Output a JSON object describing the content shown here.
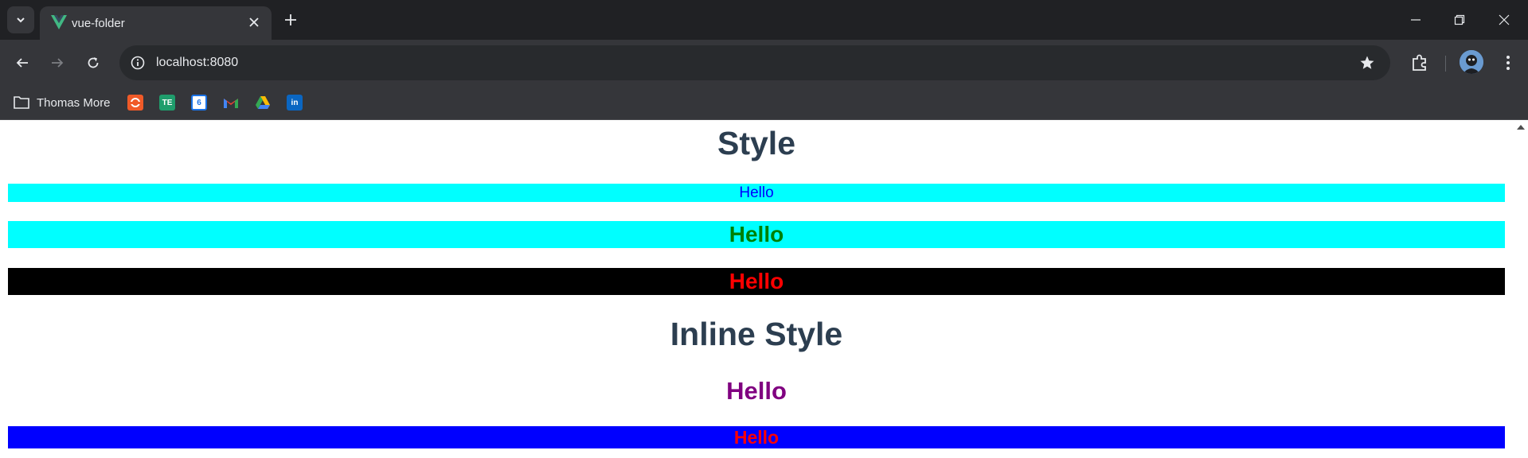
{
  "browser": {
    "tab": {
      "title": "vue-folder",
      "favicon_icon": "vue-logo-icon"
    },
    "address_bar": {
      "url": "localhost:8080"
    },
    "bookmarks": {
      "folder_label": "Thomas More",
      "items": [
        {
          "icon": "bookmark-orange-icon",
          "text": "",
          "color": "#f05a28"
        },
        {
          "icon": "bookmark-te-icon",
          "text": "TE",
          "color": "#1f9d6c"
        },
        {
          "icon": "google-calendar-icon",
          "text": "6",
          "color": "#1a73e8"
        },
        {
          "icon": "gmail-icon",
          "text": "M",
          "color": "#ffffff"
        },
        {
          "icon": "google-drive-icon",
          "text": "",
          "color": "#34a853"
        },
        {
          "icon": "linkedin-icon",
          "text": "in",
          "color": "#0a66c2"
        }
      ]
    }
  },
  "page": {
    "heading_style": "Style",
    "heading_inline": "Inline Style",
    "rows": [
      {
        "text": "Hello",
        "bg": "#00ffff",
        "color": "#0000ff"
      },
      {
        "text": "Hello",
        "bg": "#00ffff",
        "color": "#008000"
      },
      {
        "text": "Hello",
        "bg": "#000000",
        "color": "#ff0000"
      },
      {
        "text": "Hello",
        "bg": "transparent",
        "color": "#800080"
      },
      {
        "text": "Hello",
        "bg": "#0000ff",
        "color": "#ff0000"
      }
    ]
  }
}
